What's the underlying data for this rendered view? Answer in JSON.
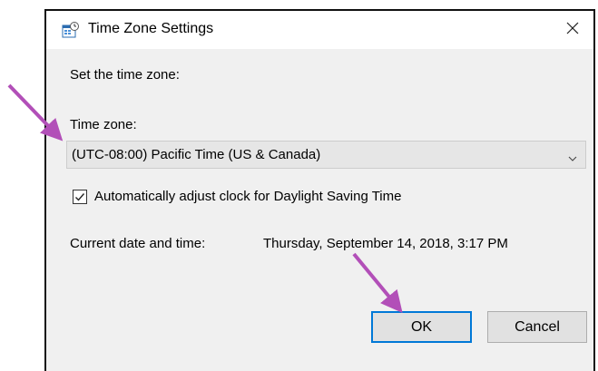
{
  "window": {
    "title": "Time Zone Settings",
    "title_icon": "calendar-clock-icon",
    "close_icon": "close-icon"
  },
  "dialog": {
    "prompt": "Set the time zone:",
    "timezone_label": "Time zone:",
    "timezone_value": "(UTC-08:00) Pacific Time (US & Canada)",
    "dst_checked": true,
    "dst_label": "Automatically adjust clock for Daylight Saving Time",
    "current_label": "Current date and time:",
    "current_value": "Thursday, September 14, 2018, 3:17 PM"
  },
  "buttons": {
    "ok": "OK",
    "cancel": "Cancel"
  },
  "colors": {
    "annotation_arrow": "#b24fb8",
    "default_button_border": "#0078d7"
  }
}
